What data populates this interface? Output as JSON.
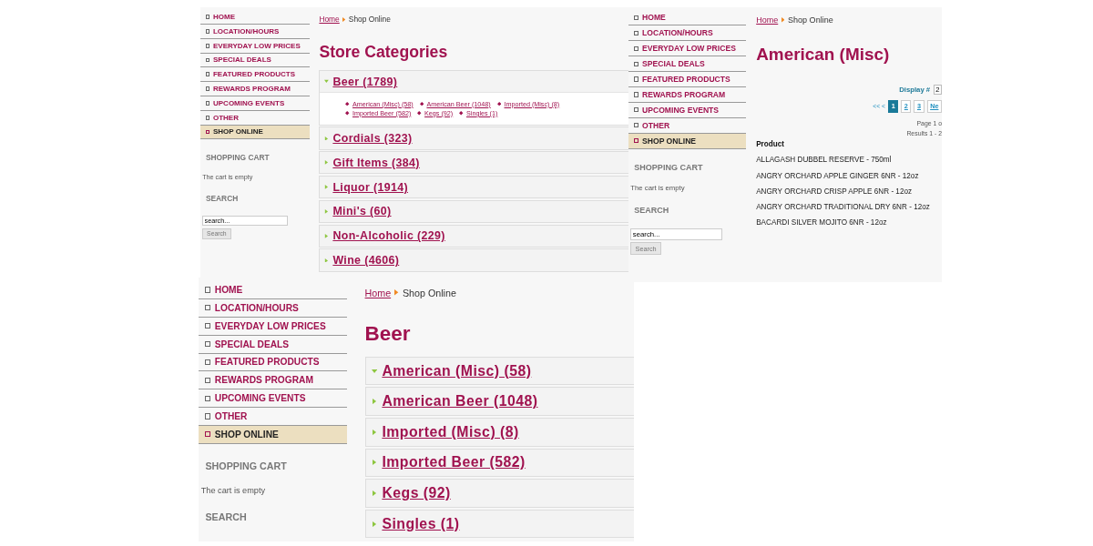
{
  "screenshots": [
    {
      "kind": "categories",
      "sidebar": {
        "nav": [
          {
            "label": "HOME",
            "selected": false
          },
          {
            "label": "LOCATION/HOURS",
            "selected": false
          },
          {
            "label": "EVERYDAY LOW PRICES",
            "selected": false
          },
          {
            "label": "SPECIAL DEALS",
            "selected": false
          },
          {
            "label": "FEATURED PRODUCTS",
            "selected": false
          },
          {
            "label": "REWARDS PROGRAM",
            "selected": false
          },
          {
            "label": "UPCOMING EVENTS",
            "selected": false
          },
          {
            "label": "OTHER",
            "selected": false
          },
          {
            "label": "SHOP ONLINE",
            "selected": true
          }
        ],
        "cart_heading": "SHOPPING CART",
        "cart_text": "The cart is empty",
        "search_heading": "SEARCH",
        "search": {
          "value": "search...",
          "button": "Search"
        }
      },
      "breadcrumb": {
        "home": "Home",
        "current": "Shop Online"
      },
      "title": "Store Categories",
      "categories": [
        {
          "label": "Beer (1789)",
          "expanded": true,
          "children": [
            {
              "label": "American (Misc) (58)"
            },
            {
              "label": "American Beer (1048)"
            },
            {
              "label": "Imported (Misc) (8)"
            },
            {
              "label": "Imported Beer (582)"
            },
            {
              "label": "Kegs (92)"
            },
            {
              "label": "Singles (1)"
            }
          ]
        },
        {
          "label": "Cordials (323)",
          "expanded": false
        },
        {
          "label": "Gift Items (384)",
          "expanded": false
        },
        {
          "label": "Liquor (1914)",
          "expanded": false
        },
        {
          "label": "Mini's (60)",
          "expanded": false
        },
        {
          "label": "Non-Alcoholic (229)",
          "expanded": false
        },
        {
          "label": "Wine (4606)",
          "expanded": false
        }
      ]
    },
    {
      "kind": "product_list",
      "sidebar": {
        "nav": [
          {
            "label": "HOME",
            "selected": false
          },
          {
            "label": "LOCATION/HOURS",
            "selected": false
          },
          {
            "label": "EVERYDAY LOW PRICES",
            "selected": false
          },
          {
            "label": "SPECIAL DEALS",
            "selected": false
          },
          {
            "label": "FEATURED PRODUCTS",
            "selected": false
          },
          {
            "label": "REWARDS PROGRAM",
            "selected": false
          },
          {
            "label": "UPCOMING EVENTS",
            "selected": false
          },
          {
            "label": "OTHER",
            "selected": false
          },
          {
            "label": "SHOP ONLINE",
            "selected": true
          }
        ],
        "cart_heading": "SHOPPING CART",
        "cart_text": "The cart is empty",
        "search_heading": "SEARCH",
        "search": {
          "value": "search...",
          "button": "Search"
        }
      },
      "breadcrumb": {
        "home": "Home",
        "current": "Shop Online"
      },
      "title": "American (Misc)",
      "display_label": "Display #",
      "display_value": "2",
      "pager": {
        "first_prev": "<< <",
        "pages": [
          {
            "label": "1",
            "selected": true
          },
          {
            "label": "2",
            "selected": false
          },
          {
            "label": "3",
            "selected": false
          }
        ],
        "next": "Ne"
      },
      "page_info": "Page 1 o",
      "results": "Results 1 - 2",
      "table": {
        "columns": [
          "Product"
        ],
        "rows": [
          [
            "ALLAGASH DUBBEL RESERVE - 750ml"
          ],
          [
            "ANGRY ORCHARD APPLE GINGER 6NR - 12oz"
          ],
          [
            "ANGRY ORCHARD CRISP APPLE 6NR - 12oz"
          ],
          [
            "ANGRY ORCHARD TRADITIONAL DRY 6NR - 12oz"
          ],
          [
            "BACARDI SILVER MOJITO 6NR - 12oz"
          ]
        ]
      }
    },
    {
      "kind": "categories",
      "sidebar": {
        "nav": [
          {
            "label": "HOME",
            "selected": false
          },
          {
            "label": "LOCATION/HOURS",
            "selected": false
          },
          {
            "label": "EVERYDAY LOW PRICES",
            "selected": false
          },
          {
            "label": "SPECIAL DEALS",
            "selected": false
          },
          {
            "label": "FEATURED PRODUCTS",
            "selected": false
          },
          {
            "label": "REWARDS PROGRAM",
            "selected": false
          },
          {
            "label": "UPCOMING EVENTS",
            "selected": false
          },
          {
            "label": "OTHER",
            "selected": false
          },
          {
            "label": "SHOP ONLINE",
            "selected": true
          }
        ],
        "cart_heading": "SHOPPING CART",
        "cart_text": "The cart is empty",
        "search_heading": "SEARCH"
      },
      "breadcrumb": {
        "home": "Home",
        "current": "Shop Online"
      },
      "title": "Beer",
      "categories": [
        {
          "label": "American (Misc) (58)",
          "expanded": true
        },
        {
          "label": "American Beer (1048)",
          "expanded": false
        },
        {
          "label": "Imported (Misc) (8)",
          "expanded": false
        },
        {
          "label": "Imported Beer (582)",
          "expanded": false
        },
        {
          "label": "Kegs (92)",
          "expanded": false
        },
        {
          "label": "Singles (1)",
          "expanded": false
        }
      ]
    }
  ]
}
